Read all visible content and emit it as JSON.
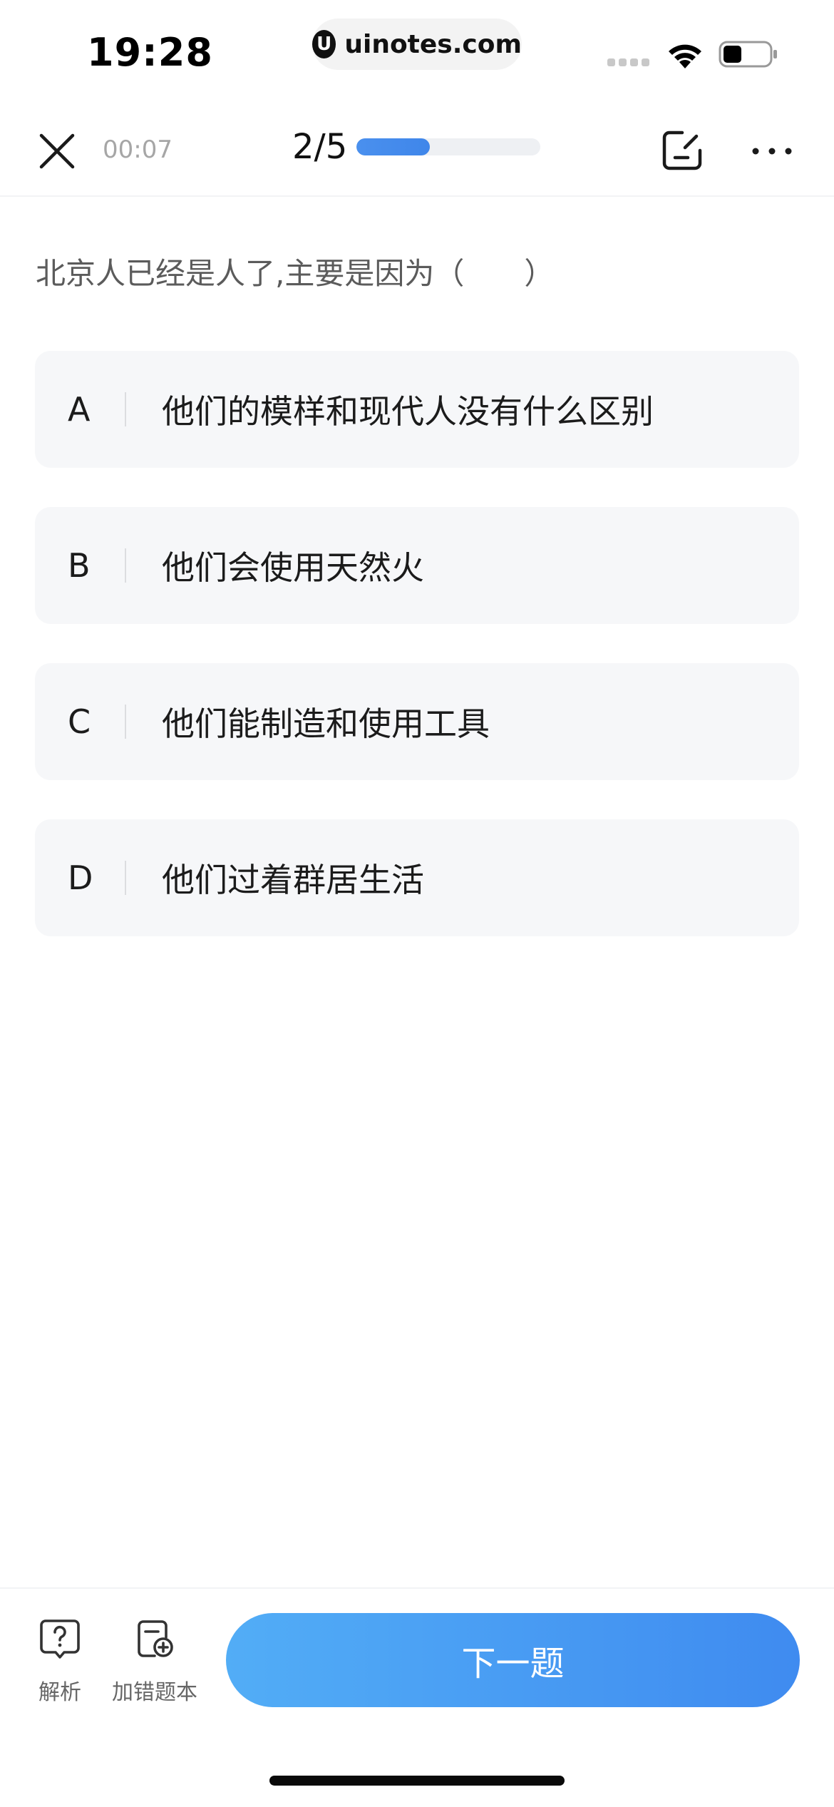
{
  "status_bar": {
    "time": "19:28",
    "url": "uinotes.com",
    "url_logo_letter": "U",
    "battery_level": 0.4
  },
  "topnav": {
    "timer": "00:07",
    "progress_label": "2/5",
    "progress_fraction": 0.4,
    "icons": [
      "close-icon",
      "edit-note-icon",
      "more-icon"
    ]
  },
  "question": {
    "text": "北京人已经是人了,主要是因为（　　）"
  },
  "options": [
    {
      "letter": "A",
      "text": "他们的模样和现代人没有什么区别"
    },
    {
      "letter": "B",
      "text": "他们会使用天然火"
    },
    {
      "letter": "C",
      "text": "他们能制造和使用工具"
    },
    {
      "letter": "D",
      "text": "他们过着群居生活"
    }
  ],
  "bottom": {
    "analysis_label": "解析",
    "mistake_label": "加错题本",
    "next_label": "下一题"
  },
  "colors": {
    "accent_blue": "#3f86ea",
    "button_gradient_start": "#52adf6",
    "button_gradient_end": "#3f8bf0",
    "option_background": "#f6f7f9"
  }
}
